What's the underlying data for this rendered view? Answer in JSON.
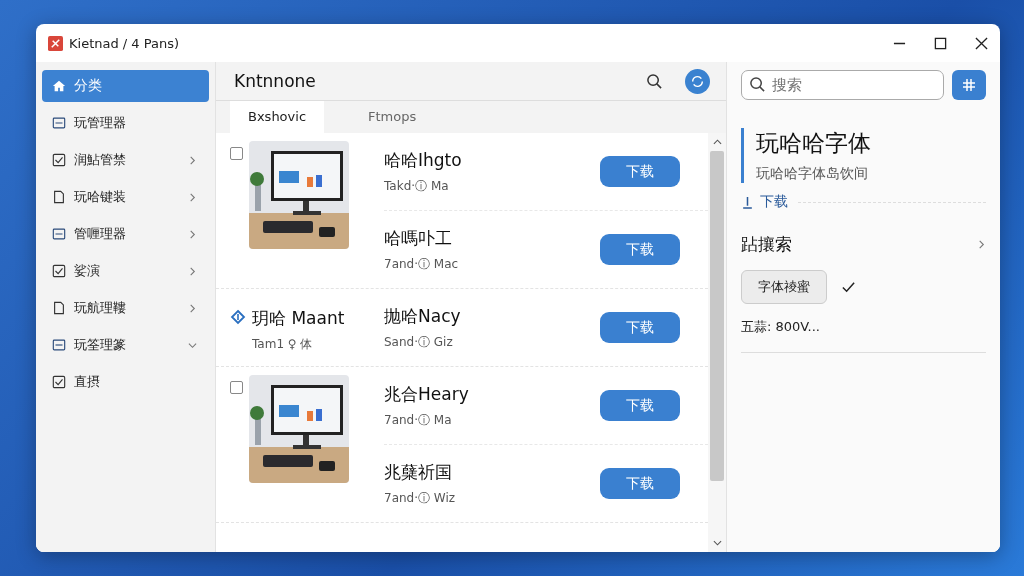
{
  "window": {
    "title": "Kietnad / 4 Pans)"
  },
  "sidebar": {
    "items": [
      {
        "label": "分类",
        "selected": true
      },
      {
        "label": "玩管理器",
        "selected": false
      },
      {
        "label": "润鮎管禁",
        "selected": false,
        "expanded": false
      },
      {
        "label": "玩哈键装",
        "selected": false,
        "expanded": false
      },
      {
        "label": "管喱理器",
        "selected": false,
        "expanded": false
      },
      {
        "label": "娑演",
        "selected": false,
        "expanded": false
      },
      {
        "label": "玩航理鞻",
        "selected": false,
        "expanded": false
      },
      {
        "label": "玩筌理篆",
        "selected": false,
        "expanded": true
      },
      {
        "label": "直摂",
        "selected": false
      }
    ]
  },
  "main": {
    "title": "Kntnnone",
    "tabs": [
      {
        "label": "Bxshovic",
        "selected": true
      },
      {
        "label": "Ftmops",
        "selected": false
      }
    ],
    "groups": [
      {
        "kind": "picture",
        "checked": false,
        "entries": [
          {
            "title": "哈哈Ihgto",
            "subtitle": "Takd·ⓘ Ma",
            "button": "下载"
          },
          {
            "title": "哈嗎卟工",
            "subtitle": "7and·ⓘ Mac",
            "button": "下载"
          }
        ]
      },
      {
        "kind": "lead",
        "title": "玥哈 Maant",
        "subtitle": "Tam1 ♀ 体",
        "entries": [
          {
            "title": "抛哈Nacy",
            "subtitle": "Sand·ⓘ Giz",
            "button": "下载"
          }
        ]
      },
      {
        "kind": "picture",
        "checked": false,
        "entries": [
          {
            "title": "兆合Heary",
            "subtitle": "7and·ⓘ Ma",
            "button": "下载"
          },
          {
            "title": "兆蘖祈国",
            "subtitle": "7and·ⓘ Wiz",
            "button": "下载"
          }
        ]
      }
    ]
  },
  "details": {
    "search": {
      "placeholder": "搜索"
    },
    "title": "玩哈哈字体",
    "subtitle": "玩哈哈字体岛饮间",
    "download_link": "下载",
    "section": "跕攘索",
    "chip": {
      "label": "字体祾蜜",
      "checked": true
    },
    "note": "五蒜: 800V..."
  }
}
